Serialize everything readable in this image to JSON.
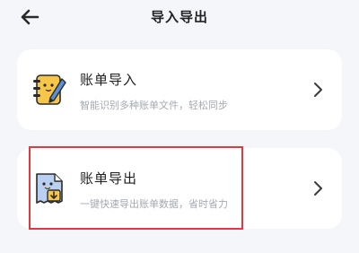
{
  "header": {
    "title": "导入导出",
    "back_icon": "arrow-left-icon"
  },
  "cards": [
    {
      "title": "账单导入",
      "description": "智能识别多种账单文件，轻松同步",
      "icon": "notebook-pen-icon",
      "chevron_icon": "chevron-right-icon"
    },
    {
      "title": "账单导出",
      "description": "一键快速导出账单数据，省时省力",
      "icon": "document-export-icon",
      "chevron_icon": "chevron-right-icon"
    }
  ],
  "colors": {
    "background": "#f4f6fa",
    "card": "#ffffff",
    "accent_yellow": "#f6c64a",
    "accent_blue": "#5a8fd8",
    "highlight": "#e0393e"
  }
}
